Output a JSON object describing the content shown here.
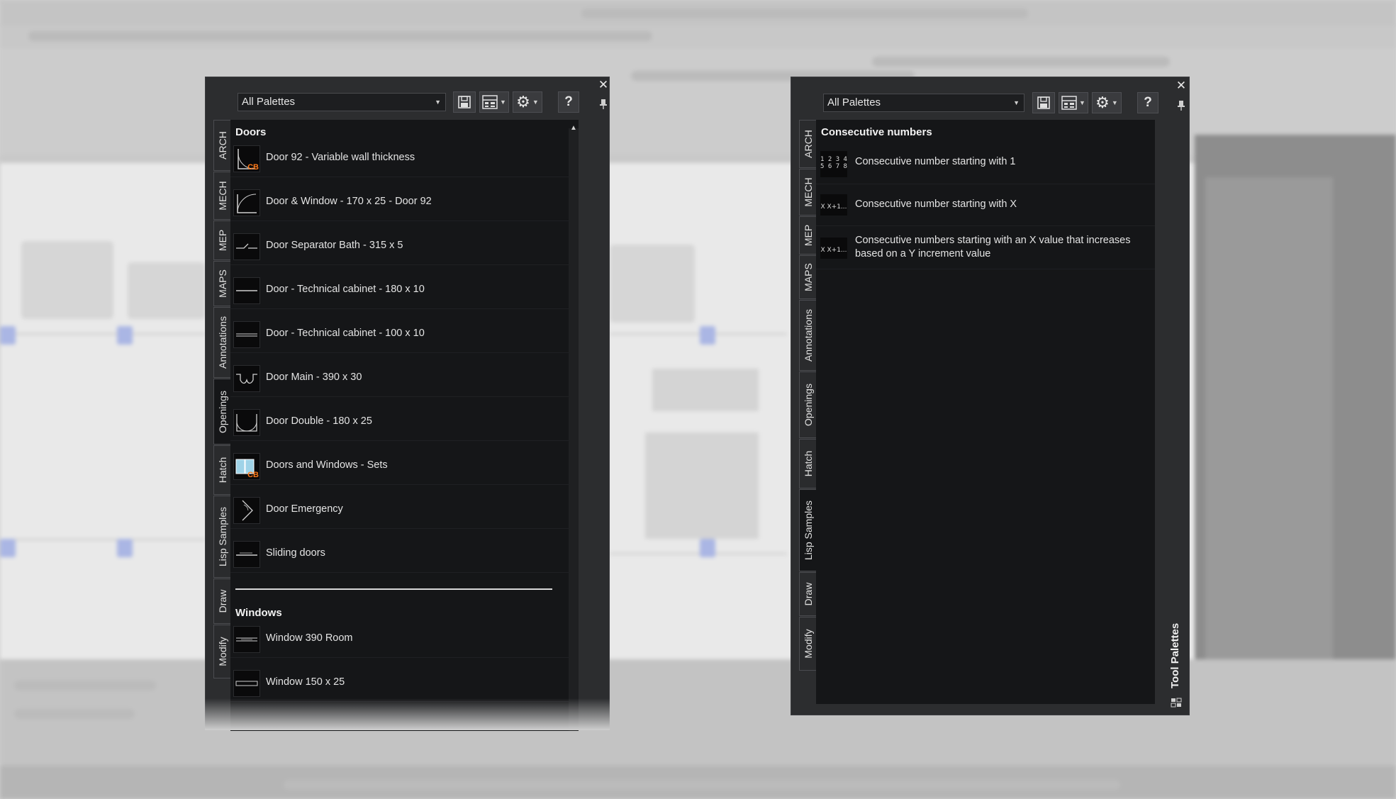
{
  "left_palette": {
    "dropdown_value": "All Palettes",
    "tabs": [
      "ARCH",
      "MECH",
      "MEP",
      "MAPS",
      "Annotations",
      "Openings",
      "Hatch",
      "Lisp Samples",
      "Draw",
      "Modify"
    ],
    "sections": [
      {
        "title": "Doors",
        "items": [
          {
            "label": "Door 92 - Variable wall thickness",
            "icon": "door-arc-cb-icon"
          },
          {
            "label": "Door & Window - 170 x 25 - Door 92",
            "icon": "door-arc-icon"
          },
          {
            "label": "Door Separator Bath - 315 x 5",
            "icon": "door-separator-icon"
          },
          {
            "label": "Door - Technical cabinet - 180 x 10",
            "icon": "door-cabinet-icon"
          },
          {
            "label": "Door - Technical cabinet - 100 x 10",
            "icon": "door-cabinet-icon"
          },
          {
            "label": "Door Main - 390 x 30",
            "icon": "door-main-icon"
          },
          {
            "label": "Door Double - 180 x 25",
            "icon": "door-double-icon"
          },
          {
            "label": "Doors and Windows - Sets",
            "icon": "doors-windows-set-icon"
          },
          {
            "label": "Door Emergency",
            "icon": "door-emergency-icon"
          },
          {
            "label": "Sliding doors",
            "icon": "sliding-door-icon"
          }
        ]
      },
      {
        "title": "Windows",
        "items": [
          {
            "label": "Window 390 Room",
            "icon": "window-icon"
          },
          {
            "label": "Window 150 x 25",
            "icon": "window-icon"
          }
        ]
      }
    ],
    "cb_badge": "CB"
  },
  "right_palette": {
    "dropdown_value": "All Palettes",
    "tabs": [
      "ARCH",
      "MECH",
      "MEP",
      "MAPS",
      "Annotations",
      "Openings",
      "Hatch",
      "Lisp Samples",
      "Draw",
      "Modify"
    ],
    "section_title": "Consecutive numbers",
    "items": [
      {
        "label": "Consecutive number starting with 1",
        "icon_text": "1 2 3 4\n5 6 7 8"
      },
      {
        "label": "Consecutive number starting with X",
        "icon_text": "X X+1..."
      },
      {
        "label_line1": "Consecutive numbers starting with an X value that increases",
        "label_line2": "based on a Y increment value",
        "icon_text": "X X+1..."
      }
    ],
    "vertical_title": "Tool Palettes"
  },
  "toolbar": {
    "close_glyph": "✕",
    "pin_glyph": "📌",
    "help_label": "?"
  }
}
